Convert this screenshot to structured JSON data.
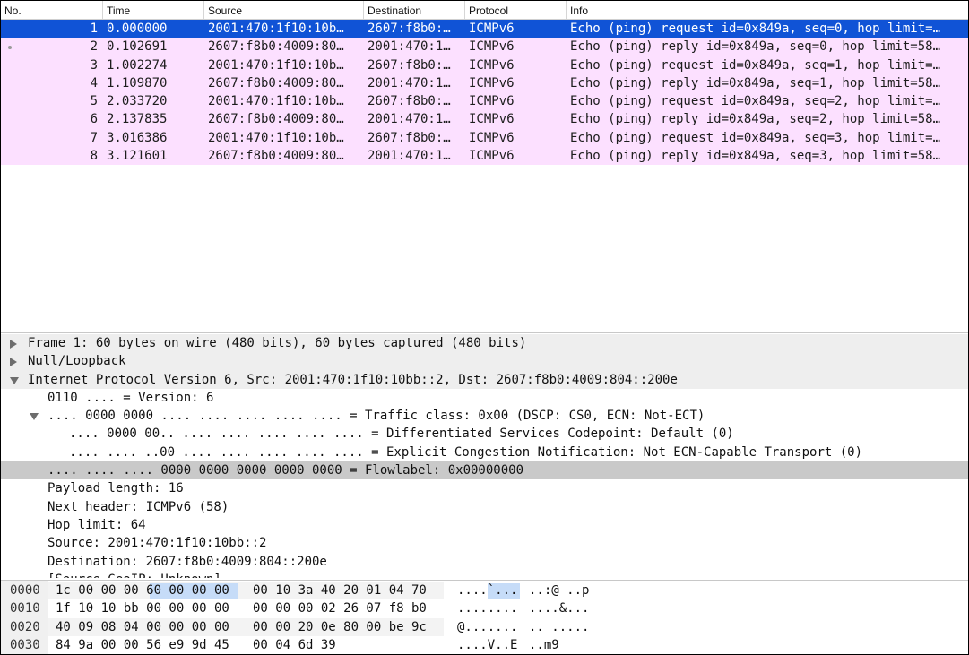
{
  "columns": [
    "No.",
    "Time",
    "Source",
    "Destination",
    "Protocol",
    "Info"
  ],
  "packets": [
    {
      "no": "1",
      "time": "0.000000",
      "src": "2001:470:1f10:10b…",
      "dst": "2607:f8b0:…",
      "proto": "ICMPv6",
      "info": "Echo (ping) request id=0x849a, seq=0, hop limit=…"
    },
    {
      "no": "2",
      "time": "0.102691",
      "src": "2607:f8b0:4009:80…",
      "dst": "2001:470:1…",
      "proto": "ICMPv6",
      "info": "Echo (ping) reply id=0x849a, seq=0, hop limit=58…"
    },
    {
      "no": "3",
      "time": "1.002274",
      "src": "2001:470:1f10:10b…",
      "dst": "2607:f8b0:…",
      "proto": "ICMPv6",
      "info": "Echo (ping) request id=0x849a, seq=1, hop limit=…"
    },
    {
      "no": "4",
      "time": "1.109870",
      "src": "2607:f8b0:4009:80…",
      "dst": "2001:470:1…",
      "proto": "ICMPv6",
      "info": "Echo (ping) reply id=0x849a, seq=1, hop limit=58…"
    },
    {
      "no": "5",
      "time": "2.033720",
      "src": "2001:470:1f10:10b…",
      "dst": "2607:f8b0:…",
      "proto": "ICMPv6",
      "info": "Echo (ping) request id=0x849a, seq=2, hop limit=…"
    },
    {
      "no": "6",
      "time": "2.137835",
      "src": "2607:f8b0:4009:80…",
      "dst": "2001:470:1…",
      "proto": "ICMPv6",
      "info": "Echo (ping) reply id=0x849a, seq=2, hop limit=58…"
    },
    {
      "no": "7",
      "time": "3.016386",
      "src": "2001:470:1f10:10b…",
      "dst": "2607:f8b0:…",
      "proto": "ICMPv6",
      "info": "Echo (ping) request id=0x849a, seq=3, hop limit=…"
    },
    {
      "no": "8",
      "time": "3.121601",
      "src": "2607:f8b0:4009:80…",
      "dst": "2001:470:1…",
      "proto": "ICMPv6",
      "info": "Echo (ping) reply id=0x849a, seq=3, hop limit=58…"
    }
  ],
  "details": [
    {
      "text": "Frame 1: 60 bytes on wire (480 bits), 60 bytes captured (480 bits)"
    },
    {
      "text": "Null/Loopback"
    },
    {
      "text": "Internet Protocol Version 6, Src: 2001:470:1f10:10bb::2, Dst: 2607:f8b0:4009:804::200e"
    },
    {
      "text": "0110 .... = Version: 6"
    },
    {
      "text": ".... 0000 0000 .... .... .... .... .... = Traffic class: 0x00 (DSCP: CS0, ECN: Not-ECT)"
    },
    {
      "text": ".... 0000 00.. .... .... .... .... .... = Differentiated Services Codepoint: Default (0)"
    },
    {
      "text": ".... .... ..00 .... .... .... .... .... = Explicit Congestion Notification: Not ECN-Capable Transport (0)"
    },
    {
      "text": ".... .... .... 0000 0000 0000 0000 0000 = Flowlabel: 0x00000000"
    },
    {
      "text": "Payload length: 16"
    },
    {
      "text": "Next header: ICMPv6 (58)"
    },
    {
      "text": "Hop limit: 64"
    },
    {
      "text": "Source: 2001:470:1f10:10bb::2"
    },
    {
      "text": "Destination: 2607:f8b0:4009:804::200e"
    },
    {
      "text": "[Source GeoIP: Unknown]"
    }
  ],
  "bytes": [
    {
      "offset": "0000",
      "hex1": "1c 00 00 00 60 00 00 00",
      "hex2": "00 10 3a 40 20 01 04 70",
      "ascii1": "....`...",
      "ascii2": "..:@ ..p"
    },
    {
      "offset": "0010",
      "hex1": "1f 10 10 bb 00 00 00 00",
      "hex2": "00 00 00 02 26 07 f8 b0",
      "ascii1": "........",
      "ascii2": "....&..."
    },
    {
      "offset": "0020",
      "hex1": "40 09 08 04 00 00 00 00",
      "hex2": "00 00 20 0e 80 00 be 9c",
      "ascii1": "@.......",
      "ascii2": ".. ....."
    },
    {
      "offset": "0030",
      "hex1": "84 9a 00 00 56 e9 9d 45",
      "hex2": "00 04 6d 39",
      "ascii1": "....V..E",
      "ascii2": "..m9"
    }
  ],
  "colors": {
    "selected_row": "#1053d6",
    "icmp_row": "#fce0ff",
    "highlight_field": "#c9c9c9",
    "byte_selection": "#c6dcf8"
  },
  "icons": [
    "expand-arrow-icon",
    "collapse-arrow-icon"
  ]
}
